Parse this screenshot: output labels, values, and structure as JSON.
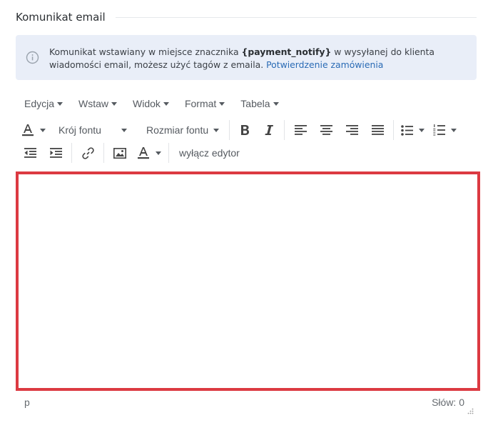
{
  "section": {
    "title": "Komunikat email"
  },
  "info": {
    "icon": "info-circle-icon",
    "text_before": "Komunikat wstawiany w miejsce znacznika ",
    "tag": "{payment_notify}",
    "text_after": " w wysyłanej do klienta wiadomości email, możesz użyć tagów z emaila. ",
    "link": "Potwierdzenie zamówienia"
  },
  "menubar": {
    "edit": "Edycja",
    "insert": "Wstaw",
    "view": "Widok",
    "format": "Format",
    "table": "Tabela"
  },
  "toolbar": {
    "font_family": "Krój fontu",
    "font_size": "Rozmiar fontu",
    "disable_editor": "wyłącz edytor",
    "icons": [
      "text-color-icon",
      "bold-icon",
      "italic-icon",
      "align-left-icon",
      "align-center-icon",
      "align-right-icon",
      "align-justify-icon",
      "bullet-list-icon",
      "numbered-list-icon",
      "outdent-icon",
      "indent-icon",
      "link-icon",
      "image-icon",
      "background-color-icon"
    ]
  },
  "statusbar": {
    "path": "p",
    "word_count": "Słów: 0"
  },
  "colors": {
    "accent_border": "#dc3a42",
    "info_bg": "#e9eef8",
    "link": "#2a6bb5"
  }
}
